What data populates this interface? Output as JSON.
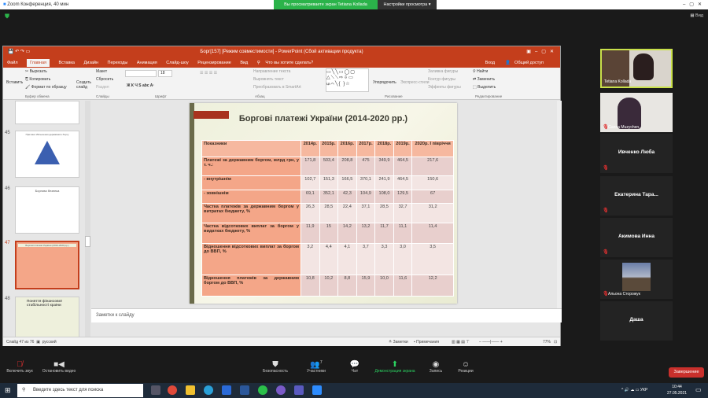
{
  "zoom": {
    "title": "Zoom Конференция, 40 мин",
    "banner": "Вы просматриваете экран Tetiana Kollada",
    "view_settings": "Настройки просмотра ▾",
    "view": "Вид",
    "participants": [
      {
        "name": "Tetiana Kollada",
        "video": true
      },
      {
        "name": "Ganna Muzychen...",
        "video": true
      },
      {
        "name": "Ивченко Люба"
      },
      {
        "name": "Екатерина  Тара..."
      },
      {
        "name": "Акимова Инна"
      },
      {
        "name": "Альона Сторожук",
        "video": true
      },
      {
        "name": "Даша"
      }
    ],
    "toolbar": {
      "unmute": "Включить звук",
      "stop_video": "Остановить видео",
      "security": "Безопасность",
      "participants": "Участники",
      "participants_count": "7",
      "chat": "Чат",
      "share": "Демонстрация экрана",
      "record": "Запись",
      "reactions": "Реакции",
      "end": "Завершение"
    }
  },
  "ppt": {
    "title": "Борг[157] [Режим совместимости] - PowerPoint (Сбой активации продукта)",
    "tabs": [
      "Файл",
      "Главная",
      "Вставка",
      "Дизайн",
      "Переходы",
      "Анимация",
      "Слайд-шоу",
      "Рецензирование",
      "Вид"
    ],
    "tell_me": "Что вы хотите сделать?",
    "signin": "Вход",
    "share": "Общий доступ",
    "ribbon": {
      "paste": "Вставить",
      "cut": "Вырезать",
      "copy": "Копировать",
      "format_painter": "Формат по образцу",
      "clipboard": "Буфер обмена",
      "new_slide": "Создать слайд",
      "layout": "Макет",
      "reset": "Сбросить",
      "section": "Раздел",
      "slides": "Слайды",
      "font_size": "18",
      "font": "Шрифт",
      "text_direction": "Направление текста",
      "align_text": "Выровнять текст",
      "smartart": "Преобразовать в SmartArt",
      "paragraph": "Абзац",
      "arrange": "Упорядочить",
      "quick_styles": "Экспресс-стили",
      "shape_fill": "Заливка фигуры",
      "shape_outline": "Контур фигуры",
      "shape_effects": "Эффекты фигуры",
      "drawing": "Рисование",
      "find": "Найти",
      "replace": "Заменить",
      "select": "Выделить",
      "editing": "Редактирование"
    },
    "thumbnails": [
      {
        "num": "45",
        "title": "Причини збільшення державного боргу"
      },
      {
        "num": "46",
        "title": "Боргова безпека"
      },
      {
        "num": "47",
        "title": "Боргові платежі України (2014-2020 рр.)"
      },
      {
        "num": "48",
        "title": "Поняття фінансової стабільності країни"
      }
    ],
    "notes_placeholder": "Заметки к слайду",
    "status": {
      "slide": "Слайд 47 из 76",
      "language": "русский",
      "notes": "Заметки",
      "comments": "Примечания",
      "zoom": "77%"
    }
  },
  "slide": {
    "title": "Боргові платежі України (2014-2020 рр.)",
    "header": [
      "Показники",
      "2014р.",
      "2015р.",
      "2016р.",
      "2017р.",
      "2018р.",
      "2019р.",
      "2020р. І півріччя"
    ],
    "rows": [
      [
        "Платежі за державним боргом, млрд грн, у т. ч.:",
        "171,8",
        "503,4",
        "208,8",
        "475",
        "349,9",
        "464,5",
        "217,6"
      ],
      [
        "-    внутрішнім",
        "102,7",
        "151,3",
        "166,5",
        "370,1",
        "241,9",
        "464,5",
        "150,6"
      ],
      [
        "-    зовнішнім",
        "69,1",
        "352,1",
        "42,3",
        "104,9",
        "108,0",
        "129,5",
        "67"
      ],
      [
        "Частка платежів за державним боргом у витратах бюджету, %",
        "26,3",
        "28,5",
        "22,4",
        "37,1",
        "28,5",
        "32,7",
        "31,2"
      ],
      [
        "Частка відсоткових виплат за боргом у видатках бюджету, %",
        "11,9",
        "15",
        "14,2",
        "13,2",
        "11,7",
        "11,1",
        "11,4"
      ],
      [
        "Відношення відсоткових виплат за боргом до ВВП, %",
        "3,2",
        "4,4",
        "4,1",
        "3,7",
        "3,3",
        "3,0",
        "3,5"
      ],
      [
        "Відношення платежів за державним боргом до ВВП, %",
        "10,8",
        "10,2",
        "8,8",
        "15,9",
        "10,0",
        "11,6",
        "12,2"
      ]
    ]
  },
  "taskbar": {
    "search": "Введите здесь текст для поиска",
    "lang": "УКР",
    "time": "10:44",
    "date": "27.05.2021"
  }
}
